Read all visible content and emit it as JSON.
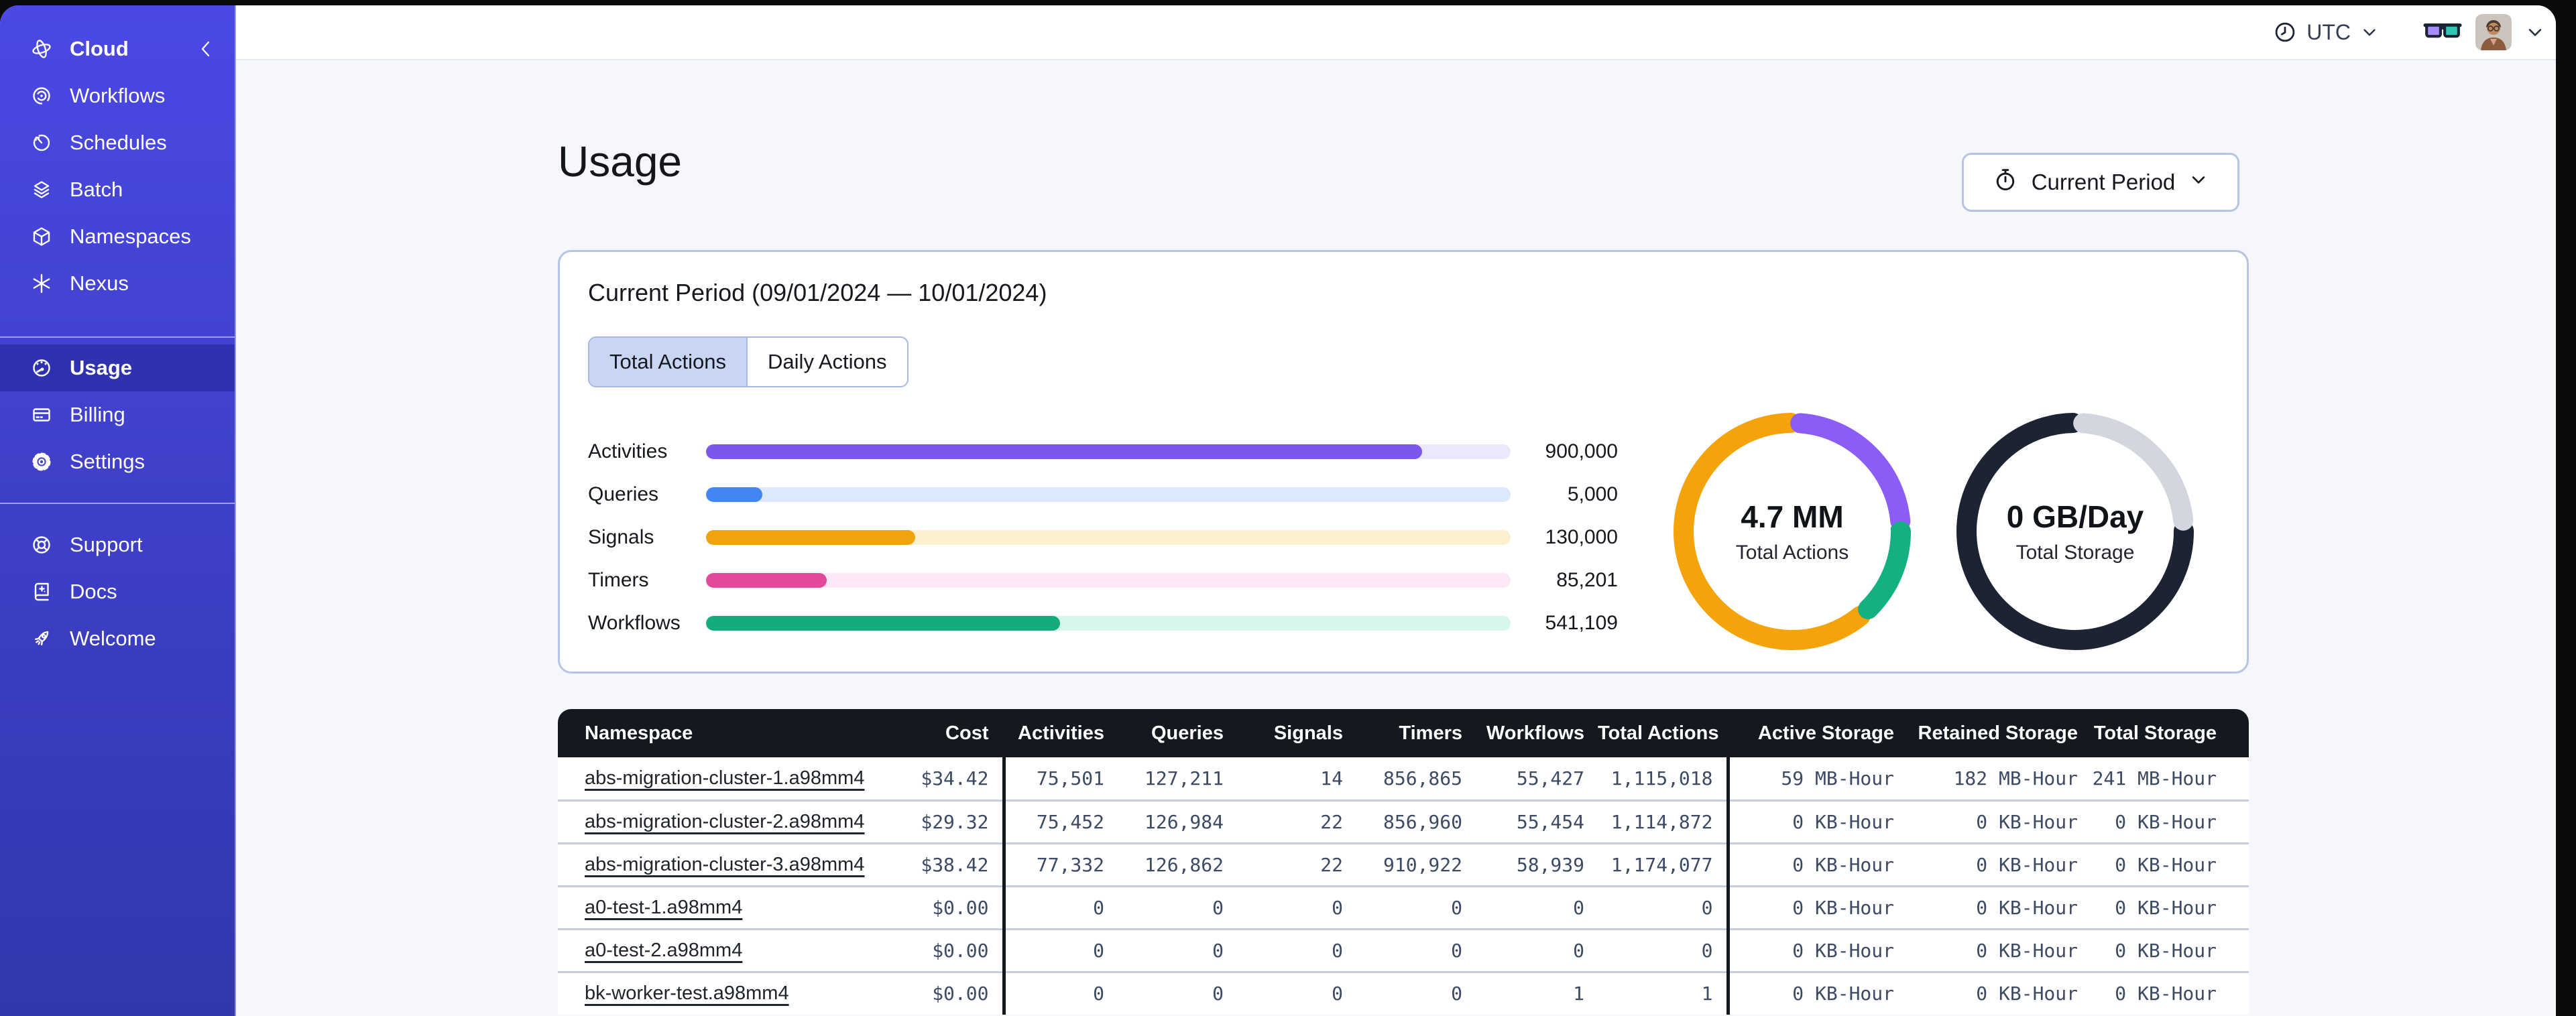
{
  "topbar": {
    "timezone_label": "UTC"
  },
  "sidebar": {
    "primary": [
      {
        "label": "Cloud",
        "icon": "cloud-orbit-icon",
        "active": false,
        "emphasis": true,
        "collapse": true
      },
      {
        "label": "Workflows",
        "icon": "workflows-spiral-icon",
        "active": false
      },
      {
        "label": "Schedules",
        "icon": "schedule-clock-icon",
        "active": false
      },
      {
        "label": "Batch",
        "icon": "batch-layers-icon",
        "active": false
      },
      {
        "label": "Namespaces",
        "icon": "namespace-cube-icon",
        "active": false
      },
      {
        "label": "Nexus",
        "icon": "nexus-asterisk-icon",
        "active": false
      }
    ],
    "account": [
      {
        "label": "Usage",
        "icon": "usage-gauge-icon",
        "active": true,
        "emphasis": true
      },
      {
        "label": "Billing",
        "icon": "billing-card-icon",
        "active": false
      },
      {
        "label": "Settings",
        "icon": "settings-gear-icon",
        "active": false
      }
    ],
    "footer": [
      {
        "label": "Support",
        "icon": "support-lifebuoy-icon",
        "active": false
      },
      {
        "label": "Docs",
        "icon": "docs-book-icon",
        "active": false
      },
      {
        "label": "Welcome",
        "icon": "welcome-rocket-icon",
        "active": false
      }
    ]
  },
  "page": {
    "title": "Usage"
  },
  "period_selector": {
    "label": "Current Period",
    "icon": "stopwatch-icon"
  },
  "usage_card": {
    "title": "Current Period (09/01/2024 — 10/01/2024)",
    "tabs": [
      {
        "label": "Total Actions",
        "selected": true
      },
      {
        "label": "Daily Actions",
        "selected": false
      }
    ]
  },
  "chart_data": [
    {
      "type": "bar",
      "orientation": "horizontal",
      "categories": [
        "Activities",
        "Queries",
        "Signals",
        "Timers",
        "Workflows"
      ],
      "values": [
        900000,
        5000,
        130000,
        85201,
        541109
      ],
      "value_labels": [
        "900,000",
        "5,000",
        "130,000",
        "85,201",
        "541,109"
      ],
      "fill_pct": [
        89,
        7,
        26,
        15,
        44
      ],
      "colors": [
        "#7D57EB",
        "#4186F2",
        "#F2A20D",
        "#E2499B",
        "#14AC7C"
      ],
      "track_colors": [
        "#ECE8FB",
        "#DCE8FC",
        "#FCF1CF",
        "#FCE8F6",
        "#D9F6EA"
      ],
      "title": "Total Actions by type",
      "xlabel": "",
      "ylabel": "",
      "legend": "none",
      "grid": false
    },
    {
      "type": "pie",
      "variant": "donut",
      "label": "4.7 MM",
      "sublabel": "Total Actions",
      "segments": [
        {
          "name": "orange",
          "color": "#F5A30B",
          "start": 39.2,
          "length": 60.6,
          "pct": 61
        },
        {
          "name": "purple",
          "color": "#8B5CF6",
          "start": 1.2,
          "length": 22.3,
          "pct": 23
        },
        {
          "name": "green",
          "color": "#13B181",
          "start": 25.0,
          "length": 12.7,
          "pct": 13
        }
      ]
    },
    {
      "type": "pie",
      "variant": "donut",
      "label": "0 GB/Day",
      "sublabel": "Total Storage",
      "segments": [
        {
          "name": "navy",
          "color": "#1C2434",
          "start": 24.9,
          "length": 74.8,
          "pct": 75
        },
        {
          "name": "gray",
          "color": "#D3D6DE",
          "start": 1.2,
          "length": 22.2,
          "pct": 22
        }
      ]
    }
  ],
  "table": {
    "columns": [
      "Namespace",
      "Cost",
      "Activities",
      "Queries",
      "Signals",
      "Timers",
      "Workflows",
      "Total Actions",
      "Active Storage",
      "Retained Storage",
      "Total Storage"
    ],
    "rows": [
      [
        "abs-migration-cluster-1.a98mm4",
        "$34.42",
        "75,501",
        "127,211",
        "14",
        "856,865",
        "55,427",
        "1,115,018",
        "59 MB-Hour",
        "182 MB-Hour",
        "241 MB-Hour"
      ],
      [
        "abs-migration-cluster-2.a98mm4",
        "$29.32",
        "75,452",
        "126,984",
        "22",
        "856,960",
        "55,454",
        "1,114,872",
        "0 KB-Hour",
        "0 KB-Hour",
        "0 KB-Hour"
      ],
      [
        "abs-migration-cluster-3.a98mm4",
        "$38.42",
        "77,332",
        "126,862",
        "22",
        "910,922",
        "58,939",
        "1,174,077",
        "0 KB-Hour",
        "0 KB-Hour",
        "0 KB-Hour"
      ],
      [
        "a0-test-1.a98mm4",
        "$0.00",
        "0",
        "0",
        "0",
        "0",
        "0",
        "0",
        "0 KB-Hour",
        "0 KB-Hour",
        "0 KB-Hour"
      ],
      [
        "a0-test-2.a98mm4",
        "$0.00",
        "0",
        "0",
        "0",
        "0",
        "0",
        "0",
        "0 KB-Hour",
        "0 KB-Hour",
        "0 KB-Hour"
      ],
      [
        "bk-worker-test.a98mm4",
        "$0.00",
        "0",
        "0",
        "0",
        "0",
        "1",
        "1",
        "0 KB-Hour",
        "0 KB-Hour",
        "0 KB-Hour"
      ]
    ]
  },
  "colors": {
    "sidebar_top": "#4B48E4",
    "sidebar_bottom": "#3237AC",
    "table_header_bg": "#14181F",
    "card_border": "#B7C3E7",
    "selected_tab_bg": "#C9D6F3",
    "page_bg": "#F6F7FB",
    "glasses_left_lens": "#A78BFA",
    "glasses_right_lens": "#2FC7B2"
  }
}
